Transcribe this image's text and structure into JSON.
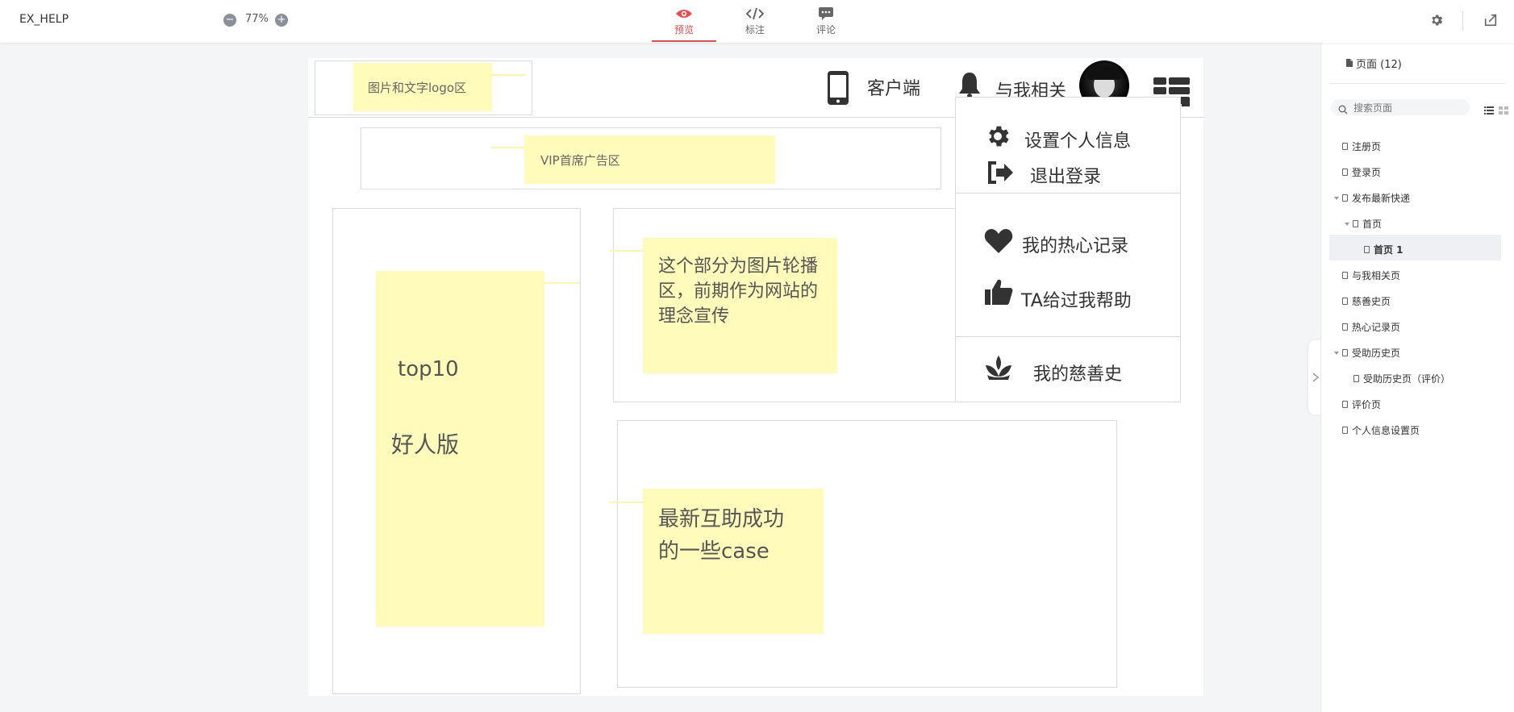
{
  "app": {
    "title": "EX_HELP",
    "zoom": "77%"
  },
  "zoom_controls": {
    "minus": "−",
    "plus": "+"
  },
  "modes": [
    {
      "label": "预览",
      "icon": "eye-icon",
      "active": true
    },
    {
      "label": "标注",
      "icon": "code-icon",
      "active": false
    },
    {
      "label": "评论",
      "icon": "comment-icon",
      "active": false
    }
  ],
  "accent": "#e94a4a",
  "wireframe": {
    "logo_note": "图片和文字logo区",
    "nav": {
      "client": "客户端",
      "related": "与我相关"
    },
    "vip_note": "VIP首席广告区",
    "top10": {
      "line1": "top10",
      "line2": "好人版"
    },
    "carousel_note": {
      "line1": "这个部分为图片轮播",
      "line2": "区，前期作为网站的",
      "line3": "理念宣传"
    },
    "cases_note": {
      "line1": "最新互助成功",
      "line2": "的一些case"
    },
    "dropdown": {
      "settings": "设置个人信息",
      "logout": "退出登录",
      "records": "我的热心记录",
      "helped": "TA给过我帮助",
      "charity": "我的慈善史"
    },
    "note_color": "#fffbba"
  },
  "panel": {
    "header": "页面 (12)",
    "search_placeholder": "搜索页面",
    "pages": [
      {
        "label": "注册页",
        "level": 0,
        "expanded": false
      },
      {
        "label": "登录页",
        "level": 0,
        "expanded": false
      },
      {
        "label": "发布最新快递",
        "level": 0,
        "expanded": true
      },
      {
        "label": "首页",
        "level": 1,
        "expanded": true
      },
      {
        "label": "首页 1",
        "level": 2,
        "selected": true
      },
      {
        "label": "与我相关页",
        "level": 0,
        "expanded": false
      },
      {
        "label": "慈善史页",
        "level": 0,
        "expanded": false
      },
      {
        "label": "热心记录页",
        "level": 0,
        "expanded": false
      },
      {
        "label": "受助历史页",
        "level": 0,
        "expanded": true
      },
      {
        "label": "受助历史页（评价）",
        "level": 1,
        "expanded": false
      },
      {
        "label": "评价页",
        "level": 0,
        "expanded": false
      },
      {
        "label": "个人信息设置页",
        "level": 0,
        "expanded": false
      }
    ]
  }
}
